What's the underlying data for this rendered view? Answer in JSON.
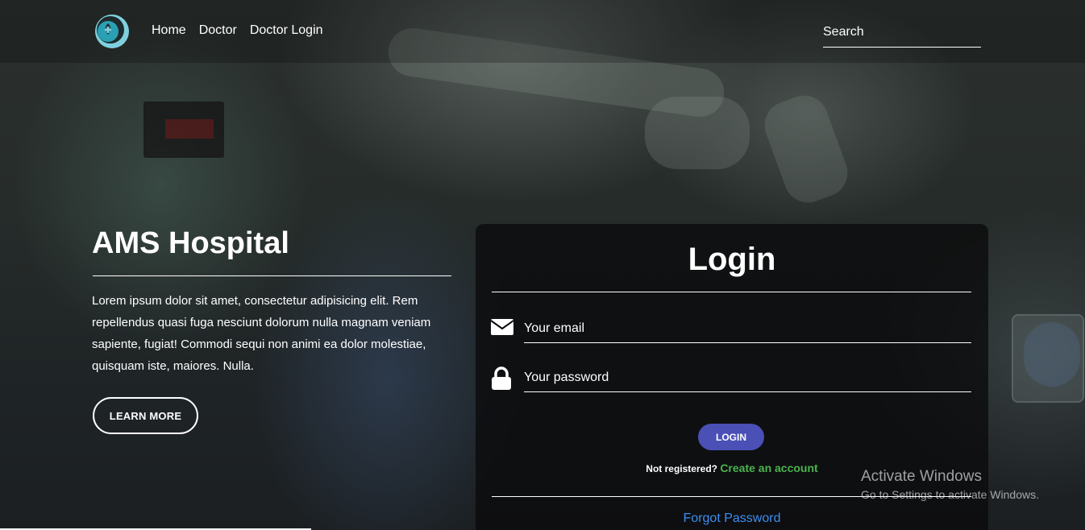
{
  "nav": {
    "links": [
      "Home",
      "Doctor",
      "Doctor Login"
    ],
    "search_placeholder": "Search"
  },
  "hero": {
    "title": "AMS Hospital",
    "text": "Lorem ipsum dolor sit amet, consectetur adipisicing elit. Rem repellendus quasi fuga nesciunt dolorum nulla magnam veniam sapiente, fugiat! Commodi sequi non animi ea dolor molestiae, quisquam iste, maiores. Nulla.",
    "button_label": "LEARN MORE"
  },
  "login": {
    "title": "Login",
    "email_placeholder": "Your email",
    "password_placeholder": "Your password",
    "button_label": "LOGIN",
    "register_prompt": "Not registered?",
    "register_link": "Create an account",
    "forgot_link": "Forgot Password"
  },
  "watermark": {
    "title": "Activate Windows",
    "subtitle": "Go to Settings to activate Windows."
  },
  "colors": {
    "login_button": "#4a50b5",
    "register_link": "#4bb44e",
    "forgot_link": "#3b8ef0"
  },
  "icons": {
    "logo": "hospital-logo-icon",
    "email": "envelope-icon",
    "password": "lock-icon"
  }
}
